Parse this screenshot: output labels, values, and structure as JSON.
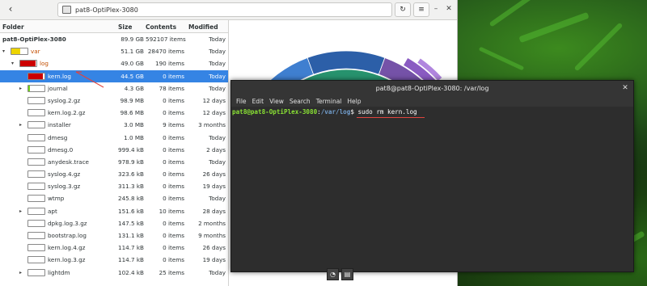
{
  "header": {
    "path": "pat8-OptiPlex-3080",
    "back_icon": "chevron-left-icon",
    "reload_icon": "reload-icon",
    "menu_icon": "hamburger-menu-icon",
    "minimize_icon": "minimize-icon",
    "close_icon": "close-icon"
  },
  "columns": {
    "folder": "Folder",
    "size": "Size",
    "contents": "Contents",
    "modified": "Modified"
  },
  "rows": [
    {
      "name": "pat8-OptiPlex-3080",
      "size": "89.9 GB",
      "items": "592107 items",
      "modified": "Today",
      "indent": 0,
      "bold": true,
      "bar": null,
      "expander": ""
    },
    {
      "name": "var",
      "size": "51.1 GB",
      "items": "28470 items",
      "modified": "Today",
      "indent": 1,
      "bar": {
        "fill": 0.57,
        "color": "#edd400"
      },
      "expander": "▾",
      "orange": true
    },
    {
      "name": "log",
      "size": "49.0 GB",
      "items": "190 items",
      "modified": "Today",
      "indent": 2,
      "bar": {
        "fill": 0.96,
        "color": "#cc0000"
      },
      "expander": "▾",
      "orange": true
    },
    {
      "name": "kern.log",
      "size": "44.5 GB",
      "items": "0 items",
      "modified": "Today",
      "indent": 3,
      "bar": {
        "fill": 0.91,
        "color": "#cc0000"
      },
      "expander": "",
      "selected": true
    },
    {
      "name": "journal",
      "size": "4.3 GB",
      "items": "78 items",
      "modified": "Today",
      "indent": 3,
      "bar": {
        "fill": 0.09,
        "color": "#73d216"
      },
      "expander": "▸"
    },
    {
      "name": "syslog.2.gz",
      "size": "98.9 MB",
      "items": "0 items",
      "modified": "12 days",
      "indent": 3,
      "bar": {
        "fill": 0.0,
        "color": "#73d216"
      },
      "expander": ""
    },
    {
      "name": "kern.log.2.gz",
      "size": "98.6 MB",
      "items": "0 items",
      "modified": "12 days",
      "indent": 3,
      "bar": {
        "fill": 0.0,
        "color": "#73d216"
      },
      "expander": ""
    },
    {
      "name": "installer",
      "size": "3.0 MB",
      "items": "9 items",
      "modified": "3 months",
      "indent": 3,
      "bar": {
        "fill": 0.0,
        "color": "#73d216"
      },
      "expander": "▸"
    },
    {
      "name": "dmesg",
      "size": "1.0 MB",
      "items": "0 items",
      "modified": "Today",
      "indent": 3,
      "bar": {
        "fill": 0.0,
        "color": "#73d216"
      },
      "expander": ""
    },
    {
      "name": "dmesg.0",
      "size": "999.4 kB",
      "items": "0 items",
      "modified": "2 days",
      "indent": 3,
      "bar": {
        "fill": 0.0,
        "color": "#73d216"
      },
      "expander": ""
    },
    {
      "name": "anydesk.trace",
      "size": "978.9 kB",
      "items": "0 items",
      "modified": "Today",
      "indent": 3,
      "bar": {
        "fill": 0.0,
        "color": "#73d216"
      },
      "expander": ""
    },
    {
      "name": "syslog.4.gz",
      "size": "323.6 kB",
      "items": "0 items",
      "modified": "26 days",
      "indent": 3,
      "bar": {
        "fill": 0.0,
        "color": "#73d216"
      },
      "expander": ""
    },
    {
      "name": "syslog.3.gz",
      "size": "311.3 kB",
      "items": "0 items",
      "modified": "19 days",
      "indent": 3,
      "bar": {
        "fill": 0.0,
        "color": "#73d216"
      },
      "expander": ""
    },
    {
      "name": "wtmp",
      "size": "245.8 kB",
      "items": "0 items",
      "modified": "Today",
      "indent": 3,
      "bar": {
        "fill": 0.0,
        "color": "#73d216"
      },
      "expander": ""
    },
    {
      "name": "apt",
      "size": "151.6 kB",
      "items": "10 items",
      "modified": "28 days",
      "indent": 3,
      "bar": {
        "fill": 0.0,
        "color": "#73d216"
      },
      "expander": "▸"
    },
    {
      "name": "dpkg.log.3.gz",
      "size": "147.5 kB",
      "items": "0 items",
      "modified": "2 months",
      "indent": 3,
      "bar": {
        "fill": 0.0,
        "color": "#73d216"
      },
      "expander": ""
    },
    {
      "name": "bootstrap.log",
      "size": "131.1 kB",
      "items": "0 items",
      "modified": "9 months",
      "indent": 3,
      "bar": {
        "fill": 0.0,
        "color": "#73d216"
      },
      "expander": ""
    },
    {
      "name": "kern.log.4.gz",
      "size": "114.7 kB",
      "items": "0 items",
      "modified": "26 days",
      "indent": 3,
      "bar": {
        "fill": 0.0,
        "color": "#73d216"
      },
      "expander": ""
    },
    {
      "name": "kern.log.3.gz",
      "size": "114.7 kB",
      "items": "0 items",
      "modified": "19 days",
      "indent": 3,
      "bar": {
        "fill": 0.0,
        "color": "#73d216"
      },
      "expander": ""
    },
    {
      "name": "lightdm",
      "size": "102.4 kB",
      "items": "25 items",
      "modified": "Today",
      "indent": 3,
      "bar": {
        "fill": 0.0,
        "color": "#73d216"
      },
      "expander": "▸"
    }
  ],
  "terminal": {
    "title": "pat8@pat8-OptiPlex-3080: /var/log",
    "menu": [
      "File",
      "Edit",
      "View",
      "Search",
      "Terminal",
      "Help"
    ],
    "prompt_user": "pat8@pat8-OptiPlex-3080",
    "prompt_sep": ":",
    "prompt_path": "/var/log",
    "prompt_end": "$ ",
    "command": "sudo rm kern.log",
    "close_icon": "close-icon"
  },
  "colors": {
    "selection": "#3584e4",
    "red_bar": "#cc0000",
    "yellow_bar": "#edd400",
    "prompt_green": "#8ae234",
    "prompt_blue": "#729fcf"
  }
}
